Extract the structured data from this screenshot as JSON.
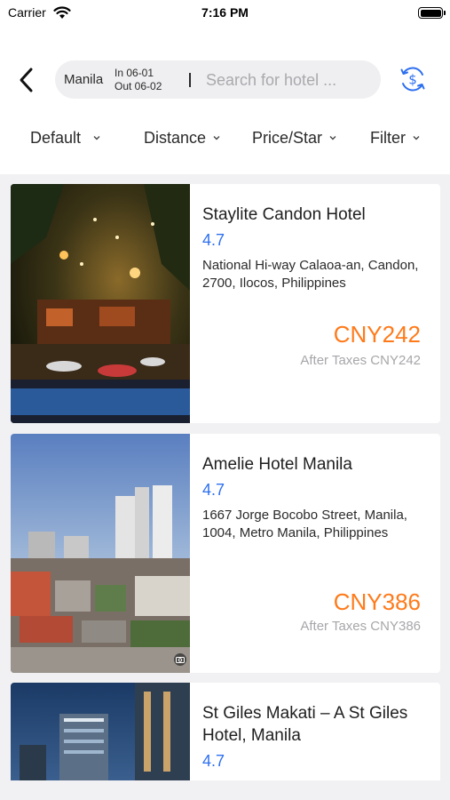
{
  "status_bar": {
    "carrier": "Carrier",
    "time": "7:16 PM"
  },
  "search": {
    "city": "Manila",
    "check_in": "In 06-01",
    "check_out": "Out 06-02",
    "placeholder": "Search for hotel ..."
  },
  "sort_bar": {
    "items": [
      {
        "label": "Default"
      },
      {
        "label": "Distance"
      },
      {
        "label": "Price/Star"
      },
      {
        "label": "Filter"
      }
    ]
  },
  "hotels": [
    {
      "name": "Staylite Candon Hotel",
      "rating": "4.7",
      "address": "National Hi-way Calaoa-an, Candon, 2700, Ilocos, Philippines",
      "price": "CNY242",
      "after_taxes": "After Taxes CNY242"
    },
    {
      "name": "Amelie Hotel Manila",
      "rating": "4.7",
      "address": "1667 Jorge Bocobo Street, Manila, 1004, Metro Manila, Philippines",
      "price": "CNY386",
      "after_taxes": "After Taxes CNY386"
    },
    {
      "name": "St Giles Makati – A St Giles Hotel, Manila",
      "rating": "4.7"
    }
  ],
  "colors": {
    "accent_blue": "#2d6ff0",
    "price_orange": "#ff7a1a",
    "muted_gray": "#a7a7ab",
    "page_bg": "#f1f1f3"
  },
  "icons": {
    "back": "chevron-left-icon",
    "currency": "currency-exchange-icon",
    "wifi": "wifi-icon",
    "battery": "battery-icon",
    "camera": "camera-icon"
  }
}
